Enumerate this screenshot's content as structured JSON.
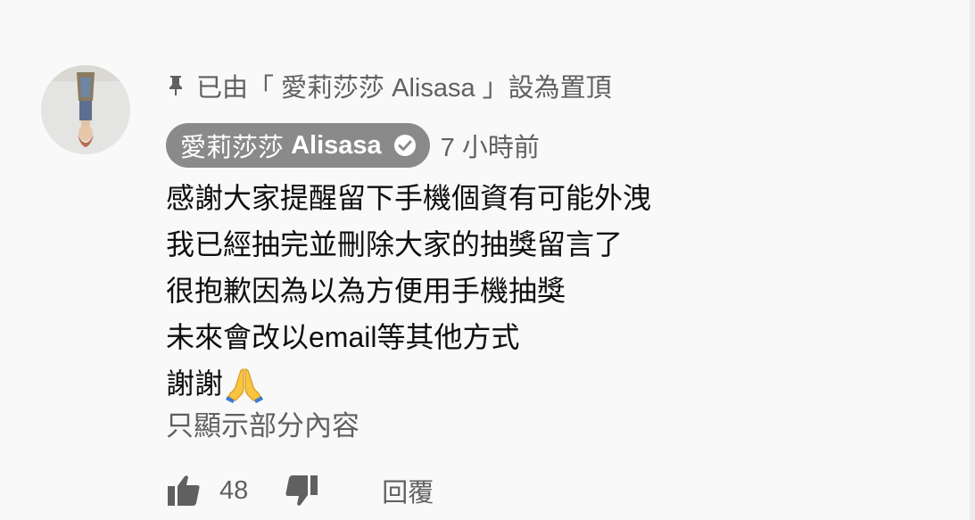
{
  "comment": {
    "pinned_text": "已由「 愛莉莎莎 Alisasa 」設為置頂",
    "author": {
      "name_cjk": "愛莉莎莎",
      "name_latin": "Alisasa",
      "verified": true
    },
    "timestamp": "7 小時前",
    "lines": [
      "感謝大家提醒留下手機個資有可能外洩",
      "我已經抽完並刪除大家的抽獎留言了",
      "很抱歉因為以為方便用手機抽獎",
      "未來會改以email等其他方式",
      "謝謝"
    ],
    "emoji": "folded-hands",
    "read_more_label": "只顯示部分內容",
    "like_count": "48",
    "reply_label": "回覆"
  },
  "colors": {
    "background": "#f9f9f9",
    "primary_text": "#0f0f0f",
    "secondary_text": "#606060",
    "author_chip": "#8a8a8a",
    "icon": "#606060"
  },
  "icons": {
    "pin": "pin-icon",
    "verified": "verified-check-icon",
    "like": "thumbs-up-icon",
    "dislike": "thumbs-down-icon"
  }
}
